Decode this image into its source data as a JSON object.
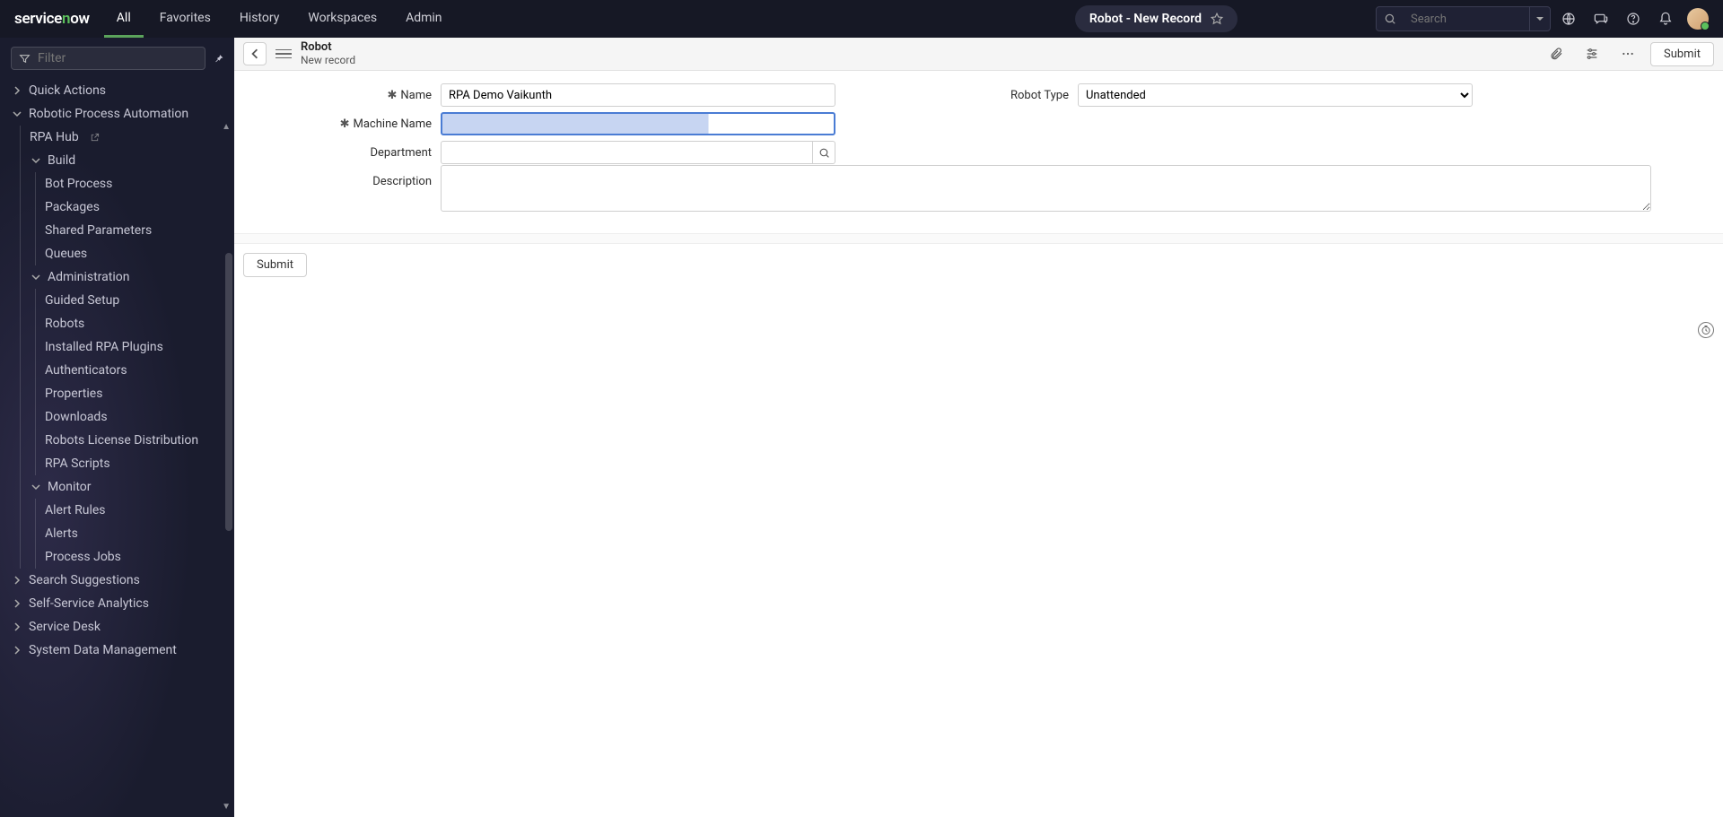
{
  "topbar": {
    "logo": "servicenow",
    "tabs": [
      "All",
      "Favorites",
      "History",
      "Workspaces",
      "Admin"
    ],
    "active_tab": 0,
    "breadcrumb": "Robot - New Record",
    "search_placeholder": "Search",
    "icons": [
      "globe-icon",
      "chat-icon",
      "help-icon",
      "bell-icon"
    ]
  },
  "sidebar": {
    "filter_placeholder": "Filter",
    "top_items": [
      {
        "label": "Quick Actions",
        "expanded": false
      }
    ],
    "rpa": {
      "label": "Robotic Process Automation",
      "expanded": true,
      "hub_label": "RPA Hub",
      "sections": [
        {
          "label": "Build",
          "expanded": true,
          "items": [
            "Bot Process",
            "Packages",
            "Shared Parameters",
            "Queues"
          ]
        },
        {
          "label": "Administration",
          "expanded": true,
          "items": [
            "Guided Setup",
            "Robots",
            "Installed RPA Plugins",
            "Authenticators",
            "Properties",
            "Downloads",
            "Robots License Distribution",
            "RPA Scripts"
          ]
        },
        {
          "label": "Monitor",
          "expanded": true,
          "items": [
            "Alert Rules",
            "Alerts",
            "Process Jobs"
          ]
        }
      ]
    },
    "bottom_items": [
      {
        "label": "Search Suggestions",
        "expanded": false
      },
      {
        "label": "Self-Service Analytics",
        "expanded": false
      },
      {
        "label": "Service Desk",
        "expanded": false
      },
      {
        "label": "System Data Management",
        "expanded": false
      }
    ]
  },
  "form_header": {
    "title": "Robot",
    "subtitle": "New record",
    "submit_label": "Submit"
  },
  "form": {
    "name_label": "Name",
    "name_value": "RPA Demo Vaikunth",
    "machine_name_label": "Machine Name",
    "machine_name_value": "",
    "department_label": "Department",
    "department_value": "",
    "description_label": "Description",
    "description_value": "",
    "robot_type_label": "Robot Type",
    "robot_type_value": "Unattended",
    "robot_type_options": [
      "Unattended"
    ]
  },
  "footer": {
    "submit_label": "Submit"
  }
}
